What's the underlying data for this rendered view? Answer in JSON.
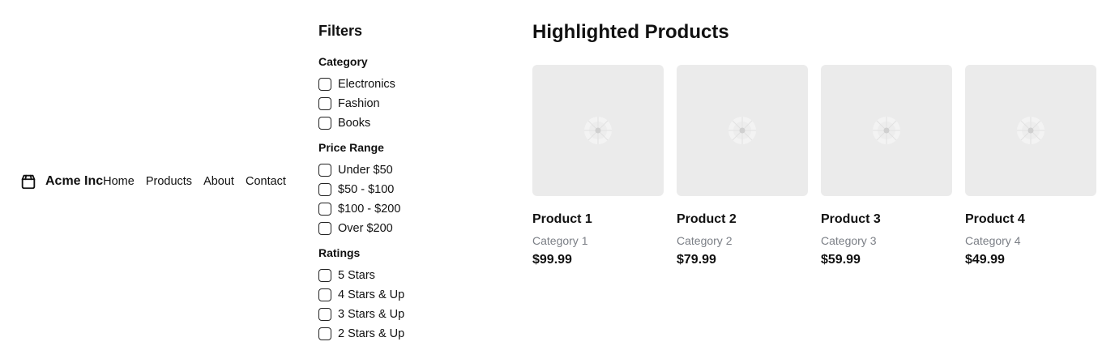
{
  "header": {
    "brand": "Acme Inc",
    "logo_icon": "package-icon",
    "nav": [
      {
        "label": "Home"
      },
      {
        "label": "Products"
      },
      {
        "label": "About"
      },
      {
        "label": "Contact"
      }
    ]
  },
  "filters": {
    "title": "Filters",
    "groups": [
      {
        "title": "Category",
        "options": [
          {
            "label": "Electronics",
            "checked": false
          },
          {
            "label": "Fashion",
            "checked": false
          },
          {
            "label": "Books",
            "checked": false
          }
        ]
      },
      {
        "title": "Price Range",
        "options": [
          {
            "label": "Under $50",
            "checked": false
          },
          {
            "label": "$50 - $100",
            "checked": false
          },
          {
            "label": "$100 - $200",
            "checked": false
          },
          {
            "label": "Over $200",
            "checked": false
          }
        ]
      },
      {
        "title": "Ratings",
        "options": [
          {
            "label": "5 Stars",
            "checked": false
          },
          {
            "label": "4 Stars & Up",
            "checked": false
          },
          {
            "label": "3 Stars & Up",
            "checked": false
          },
          {
            "label": "2 Stars & Up",
            "checked": false
          }
        ]
      }
    ]
  },
  "products": {
    "title": "Highlighted Products",
    "placeholder_icon": "image-placeholder-icon",
    "items": [
      {
        "name": "Product 1",
        "category": "Category 1",
        "price": "$99.99"
      },
      {
        "name": "Product 2",
        "category": "Category 2",
        "price": "$79.99"
      },
      {
        "name": "Product 3",
        "category": "Category 3",
        "price": "$59.99"
      },
      {
        "name": "Product 4",
        "category": "Category 4",
        "price": "$49.99"
      }
    ]
  },
  "colors": {
    "text": "#111111",
    "muted": "#7b7f86",
    "placeholder_bg": "#ebebeb"
  }
}
